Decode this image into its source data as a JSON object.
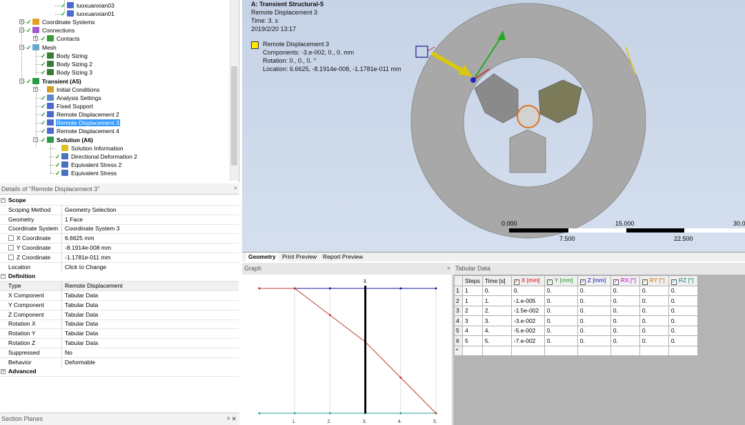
{
  "tree": {
    "items": [
      {
        "label": "luoxuanxian03",
        "icon": "body-icon"
      },
      {
        "label": "luoxuanxian01",
        "icon": "body-icon"
      },
      {
        "label": "Coordinate Systems",
        "icon": "coordinate-systems-icon"
      },
      {
        "label": "Connections",
        "icon": "connections-icon"
      },
      {
        "label": "Contacts",
        "icon": "contacts-icon"
      },
      {
        "label": "Mesh",
        "icon": "mesh-icon"
      },
      {
        "label": "Body Sizing",
        "icon": "sizing-icon"
      },
      {
        "label": "Body Sizing 2",
        "icon": "sizing-icon"
      },
      {
        "label": "Body Sizing 3",
        "icon": "sizing-icon"
      },
      {
        "label": "Transient (A5)",
        "icon": "transient-icon"
      },
      {
        "label": "Initial Conditions",
        "icon": "initial-conditions-icon"
      },
      {
        "label": "Analysis Settings",
        "icon": "analysis-settings-icon"
      },
      {
        "label": "Fixed Support",
        "icon": "fixed-support-icon"
      },
      {
        "label": "Remote Displacement 2",
        "icon": "remote-displacement-icon"
      },
      {
        "label": "Remote Displacement 3",
        "icon": "remote-displacement-icon"
      },
      {
        "label": "Remote Displacement 4",
        "icon": "remote-displacement-icon"
      },
      {
        "label": "Solution (A6)",
        "icon": "solution-icon"
      },
      {
        "label": "Solution Information",
        "icon": "solution-information-icon"
      },
      {
        "label": "Directional Deformation 2",
        "icon": "result-icon"
      },
      {
        "label": "Equivalent Stress 2",
        "icon": "result-icon"
      },
      {
        "label": "Equivalent Stress",
        "icon": "result-icon"
      }
    ]
  },
  "details": {
    "title": "Details of \"Remote Displacement 3\"",
    "rows": [
      {
        "type": "section",
        "label": "Scope",
        "toggle": "−"
      },
      {
        "label": "Scoping Method",
        "value": "Geometry Selection"
      },
      {
        "label": "Geometry",
        "value": "1 Face"
      },
      {
        "label": "Coordinate System",
        "value": "Coordinate System 3"
      },
      {
        "label": "X Coordinate",
        "value": "6.6625 mm",
        "checkbox": true
      },
      {
        "label": "Y Coordinate",
        "value": "-8.1914e-008 mm",
        "checkbox": true
      },
      {
        "label": "Z Coordinate",
        "value": "-1.1781e-011 mm",
        "checkbox": true
      },
      {
        "label": "Location",
        "value": "Click to Change"
      },
      {
        "type": "section",
        "label": "Definition",
        "toggle": "−"
      },
      {
        "label": "Type",
        "value": "Remote Displacement",
        "highlight": true
      },
      {
        "label": "X Component",
        "value": "Tabular Data"
      },
      {
        "label": "Y Component",
        "value": "Tabular Data"
      },
      {
        "label": "Z Component",
        "value": "Tabular Data"
      },
      {
        "label": "Rotation X",
        "value": "Tabular Data"
      },
      {
        "label": "Rotation Y",
        "value": "Tabular Data"
      },
      {
        "label": "Rotation Z",
        "value": "Tabular Data"
      },
      {
        "label": "Suppressed",
        "value": "No"
      },
      {
        "label": "Behavior",
        "value": "Deformable"
      },
      {
        "type": "section",
        "label": "Advanced",
        "toggle": "+"
      }
    ]
  },
  "section_planes": {
    "title": "Section Planes",
    "pin": "ᵖ ✕"
  },
  "viewport": {
    "title": "A: Transient Structural-5",
    "subtitle": "Remote Displacement 3",
    "time": "Time: 3. s",
    "date": "2019/2/20 13:17",
    "legend": {
      "name": "Remote Displacement 3",
      "components": "Components: -3.e-002, 0., 0. mm",
      "rotation": "Rotation: 0., 0., 0. °",
      "location": "Location: 6.6625, -8.1914e-008, -1.1781e-011 mm",
      "color": "#ffe600"
    },
    "scale": {
      "top_labels": [
        "0.000",
        "15.000",
        "30.0"
      ],
      "bottom_labels": [
        "7.500",
        "22.500"
      ]
    },
    "body_color": "#a8a8a8"
  },
  "tabs": [
    "Geometry",
    "Print Preview",
    "Report Preview"
  ],
  "graph": {
    "title": "Graph",
    "marker_label": "3.",
    "x_tick_labels": [
      "1.",
      "2.",
      "3.",
      "4.",
      "5."
    ]
  },
  "tabular": {
    "title": "Tabular Data",
    "columns": [
      {
        "label": "Steps",
        "checkbox": false,
        "color": "#000000"
      },
      {
        "label": "Time [s]",
        "checkbox": false,
        "color": "#000000"
      },
      {
        "label": "X [mm]",
        "checkbox": true,
        "color": "#d00000"
      },
      {
        "label": "Y [mm]",
        "checkbox": true,
        "color": "#1a9a1a"
      },
      {
        "label": "Z [mm]",
        "checkbox": true,
        "color": "#1010c0"
      },
      {
        "label": "RX [°]",
        "checkbox": true,
        "color": "#c000c0"
      },
      {
        "label": "RY [°]",
        "checkbox": true,
        "color": "#c07000"
      },
      {
        "label": "RZ [°]",
        "checkbox": true,
        "color": "#008080"
      }
    ],
    "rows": [
      {
        "n": "1",
        "cells": [
          "1",
          "0.",
          "0.",
          "0.",
          "0.",
          "0.",
          "0.",
          "0."
        ]
      },
      {
        "n": "2",
        "cells": [
          "1",
          "1.",
          "-1.e-005",
          "0.",
          "0.",
          "0.",
          "0.",
          "0."
        ]
      },
      {
        "n": "3",
        "cells": [
          "2",
          "2.",
          "-1.5e-002",
          "0.",
          "0.",
          "0.",
          "0.",
          "0."
        ]
      },
      {
        "n": "4",
        "cells": [
          "3",
          "3.",
          "-3.e-002",
          "0.",
          "0.",
          "0.",
          "0.",
          "0."
        ]
      },
      {
        "n": "5",
        "cells": [
          "4",
          "4.",
          "-5.e-002",
          "0.",
          "0.",
          "0.",
          "0.",
          "0."
        ]
      },
      {
        "n": "6",
        "cells": [
          "5",
          "5.",
          "-7.e-002",
          "0.",
          "0.",
          "0.",
          "0.",
          "0."
        ]
      },
      {
        "n": "*",
        "cells": [
          "",
          "",
          "",
          "",
          "",
          "",
          "",
          ""
        ]
      }
    ]
  },
  "chart_data": {
    "type": "line",
    "x": [
      0,
      1,
      2,
      3,
      4,
      5
    ],
    "series": [
      {
        "values": [
          0,
          -1e-05,
          -0.015,
          -0.03,
          -0.05,
          -0.07
        ],
        "color": "#c0392b"
      },
      {
        "values": [
          0,
          0,
          0,
          0,
          0,
          0
        ],
        "color": "#1010a0"
      },
      {
        "values": [
          0,
          0,
          0,
          0,
          0,
          0
        ],
        "color": "#2aa198"
      }
    ],
    "x_ticks": [
      "1.",
      "2.",
      "3.",
      "4.",
      "5."
    ],
    "current_time": 3,
    "grid": true
  }
}
